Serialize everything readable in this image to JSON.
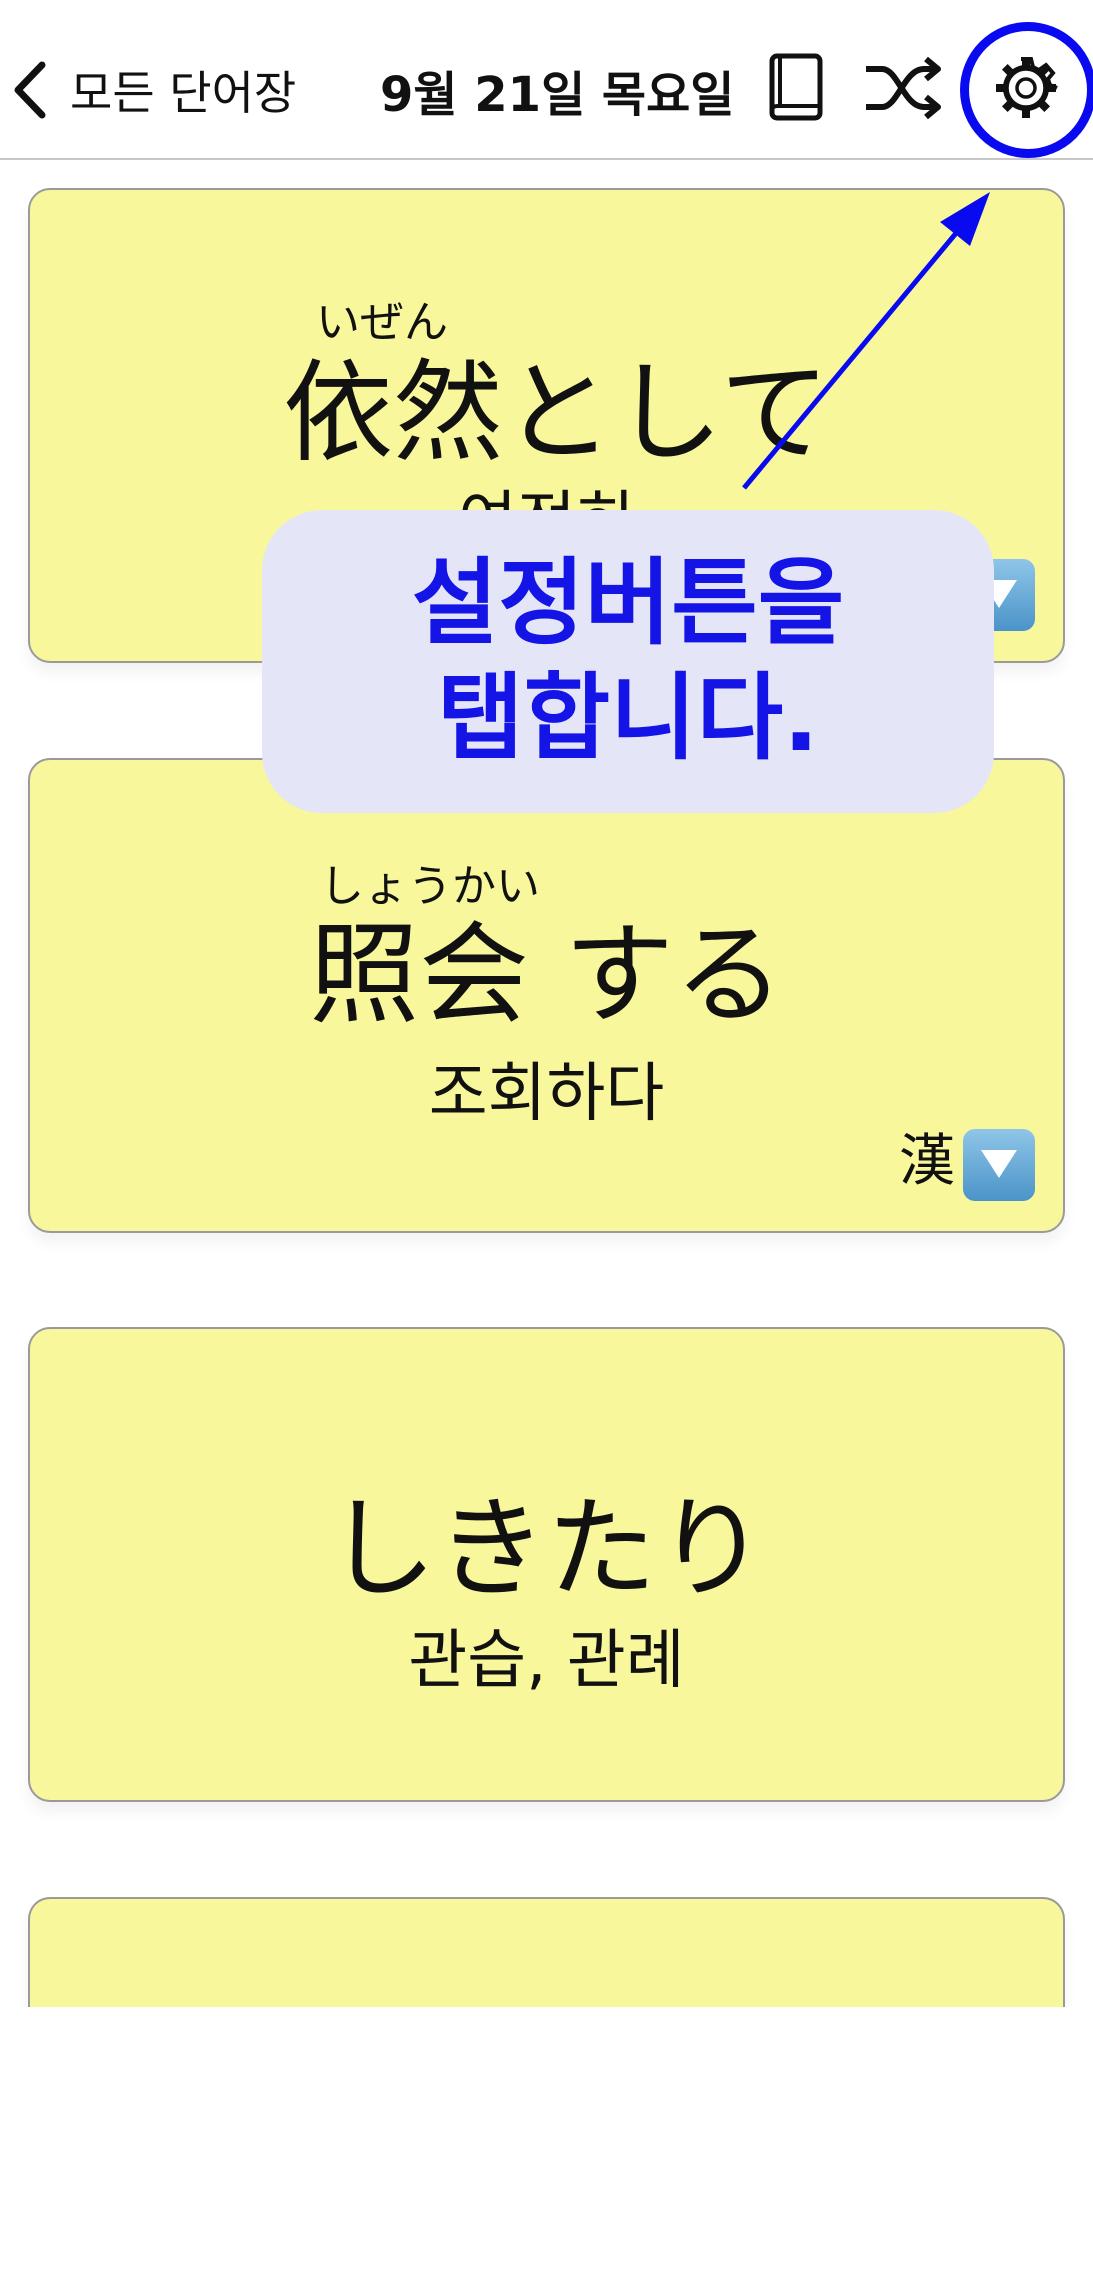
{
  "navbar": {
    "back_label": "모든 단어장",
    "title": "9월 21일 목요일",
    "icons": [
      "chevron-left-icon",
      "book-icon",
      "shuffle-icon",
      "gear-icon"
    ]
  },
  "cards": [
    {
      "furigana": "いぜん",
      "word": "依然として",
      "meaning": "여전히",
      "kanji_badge": "",
      "expand_icon": "expand-down-icon"
    },
    {
      "furigana": "しょうかい",
      "word": "照会 する",
      "meaning": "조회하다",
      "kanji_badge": "漢",
      "expand_icon": "expand-down-icon"
    },
    {
      "furigana": "",
      "word": "しきたり",
      "meaning": "관습, 관례",
      "kanji_badge": "",
      "expand_icon": ""
    },
    {
      "furigana": "",
      "word": "",
      "meaning": "",
      "kanji_badge": "",
      "expand_icon": ""
    }
  ],
  "callout": {
    "line1": "설정버튼을",
    "line2": "탭합니다."
  },
  "colors": {
    "card_bg": "#f8f79c",
    "annotation_blue": "#0a0af0",
    "callout_bg": "#e4e6f8",
    "callout_text": "#1414e6"
  }
}
